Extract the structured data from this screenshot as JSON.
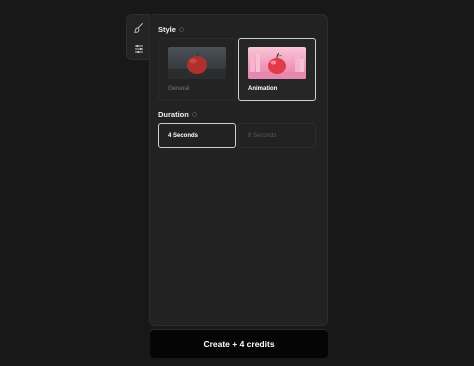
{
  "tools": {
    "items": [
      {
        "icon": "brush-icon"
      },
      {
        "icon": "sliders-icon"
      }
    ]
  },
  "style": {
    "title": "Style",
    "options": [
      {
        "label": "General",
        "selected": false
      },
      {
        "label": "Animation",
        "selected": true
      }
    ]
  },
  "duration": {
    "title": "Duration",
    "options": [
      {
        "label": "4 Seconds",
        "selected": true
      },
      {
        "label": "8 Seconds",
        "selected": false
      }
    ]
  },
  "create_button": {
    "label": "Create + 4 credits"
  },
  "colors": {
    "background": "#181818",
    "panel": "#222222",
    "selected_border": "#cfcfcf",
    "button": "#050505"
  }
}
